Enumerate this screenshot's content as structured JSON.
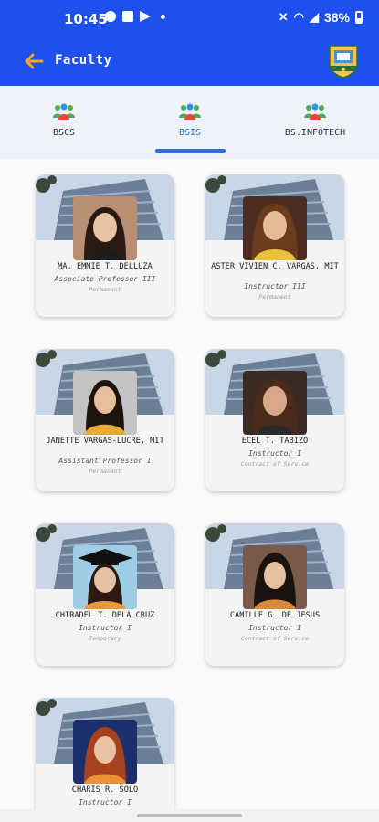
{
  "status_bar": {
    "time": "10:45",
    "battery": "38%"
  },
  "header": {
    "title": "Faculty",
    "back_icon": "arrow-left-icon",
    "logo_icon": "college-logo"
  },
  "tabs": [
    {
      "label": "BSCS",
      "icon": "people-group-icon",
      "active": false
    },
    {
      "label": "BSIS",
      "icon": "people-group-icon",
      "active": true
    },
    {
      "label": "BS.INFOTECH",
      "icon": "people-group-icon",
      "active": false
    }
  ],
  "faculty": [
    {
      "name": "MA. EMMIE T. DELLUZA",
      "title": "Associate Professor III",
      "status": "Permanent"
    },
    {
      "name": "ASTER VIVIEN C. VARGAS, MIT",
      "title": "Instructor III",
      "status": "Permanent"
    },
    {
      "name": "JANETTE VARGAS-LUCRE, MIT",
      "title": "Assistant Professor I",
      "status": "Permanent"
    },
    {
      "name": "ECEL T. TABIZO",
      "title": "Instructor I",
      "status": "Contract of Service"
    },
    {
      "name": "CHIRADEL T. DELA CRUZ",
      "title": "Instructor I",
      "status": "Temporary"
    },
    {
      "name": "CAMILLE G. DE JESUS",
      "title": "Instructor I",
      "status": "Contract of Service"
    },
    {
      "name": "CHARIS R. SOLO",
      "title": "Instructor I",
      "status": ""
    }
  ],
  "colors": {
    "primary": "#1e50f0",
    "accent_orange": "#f5a623",
    "tab_active": "#2a6fd8"
  }
}
